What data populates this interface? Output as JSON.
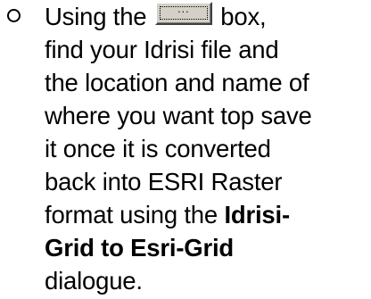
{
  "instruction": {
    "bullet_icon": "hollow-circle-bullet",
    "line1_before": "Using the ",
    "browse_button_label": "...",
    "line1_after": " box,",
    "line2": "find your Idrisi file and",
    "line3": "the location and name of",
    "line4": "where you want top save",
    "line5": "it once it is converted",
    "line6": "back into ESRI Raster",
    "line7_normal": "format using the ",
    "line7_bold": "Idrisi-",
    "line8_bold": "Grid to Esri-Grid",
    "line9": "dialogue."
  }
}
